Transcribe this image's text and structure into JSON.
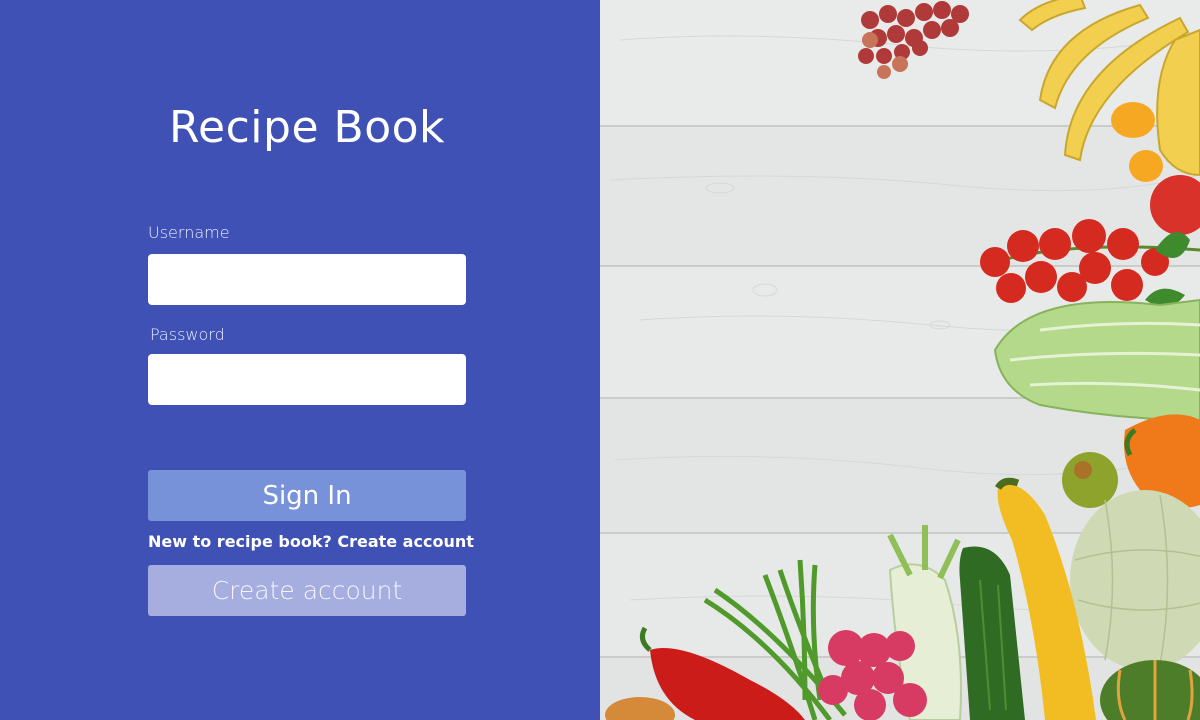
{
  "app": {
    "title": "Recipe Book"
  },
  "form": {
    "username_label": "Username",
    "username_value": "",
    "password_label": "Password",
    "password_value": "",
    "sign_in_label": "Sign In",
    "new_user_text": "New to recipe book?",
    "create_account_link": "Create account",
    "create_account_button": "Create account"
  },
  "colors": {
    "panel_background": "#3f51b5",
    "sign_in_button": "#7892d9",
    "create_account_button": "#a6aedf"
  },
  "photo": {
    "subject": "fresh vegetables and fruit on light wooden table"
  }
}
